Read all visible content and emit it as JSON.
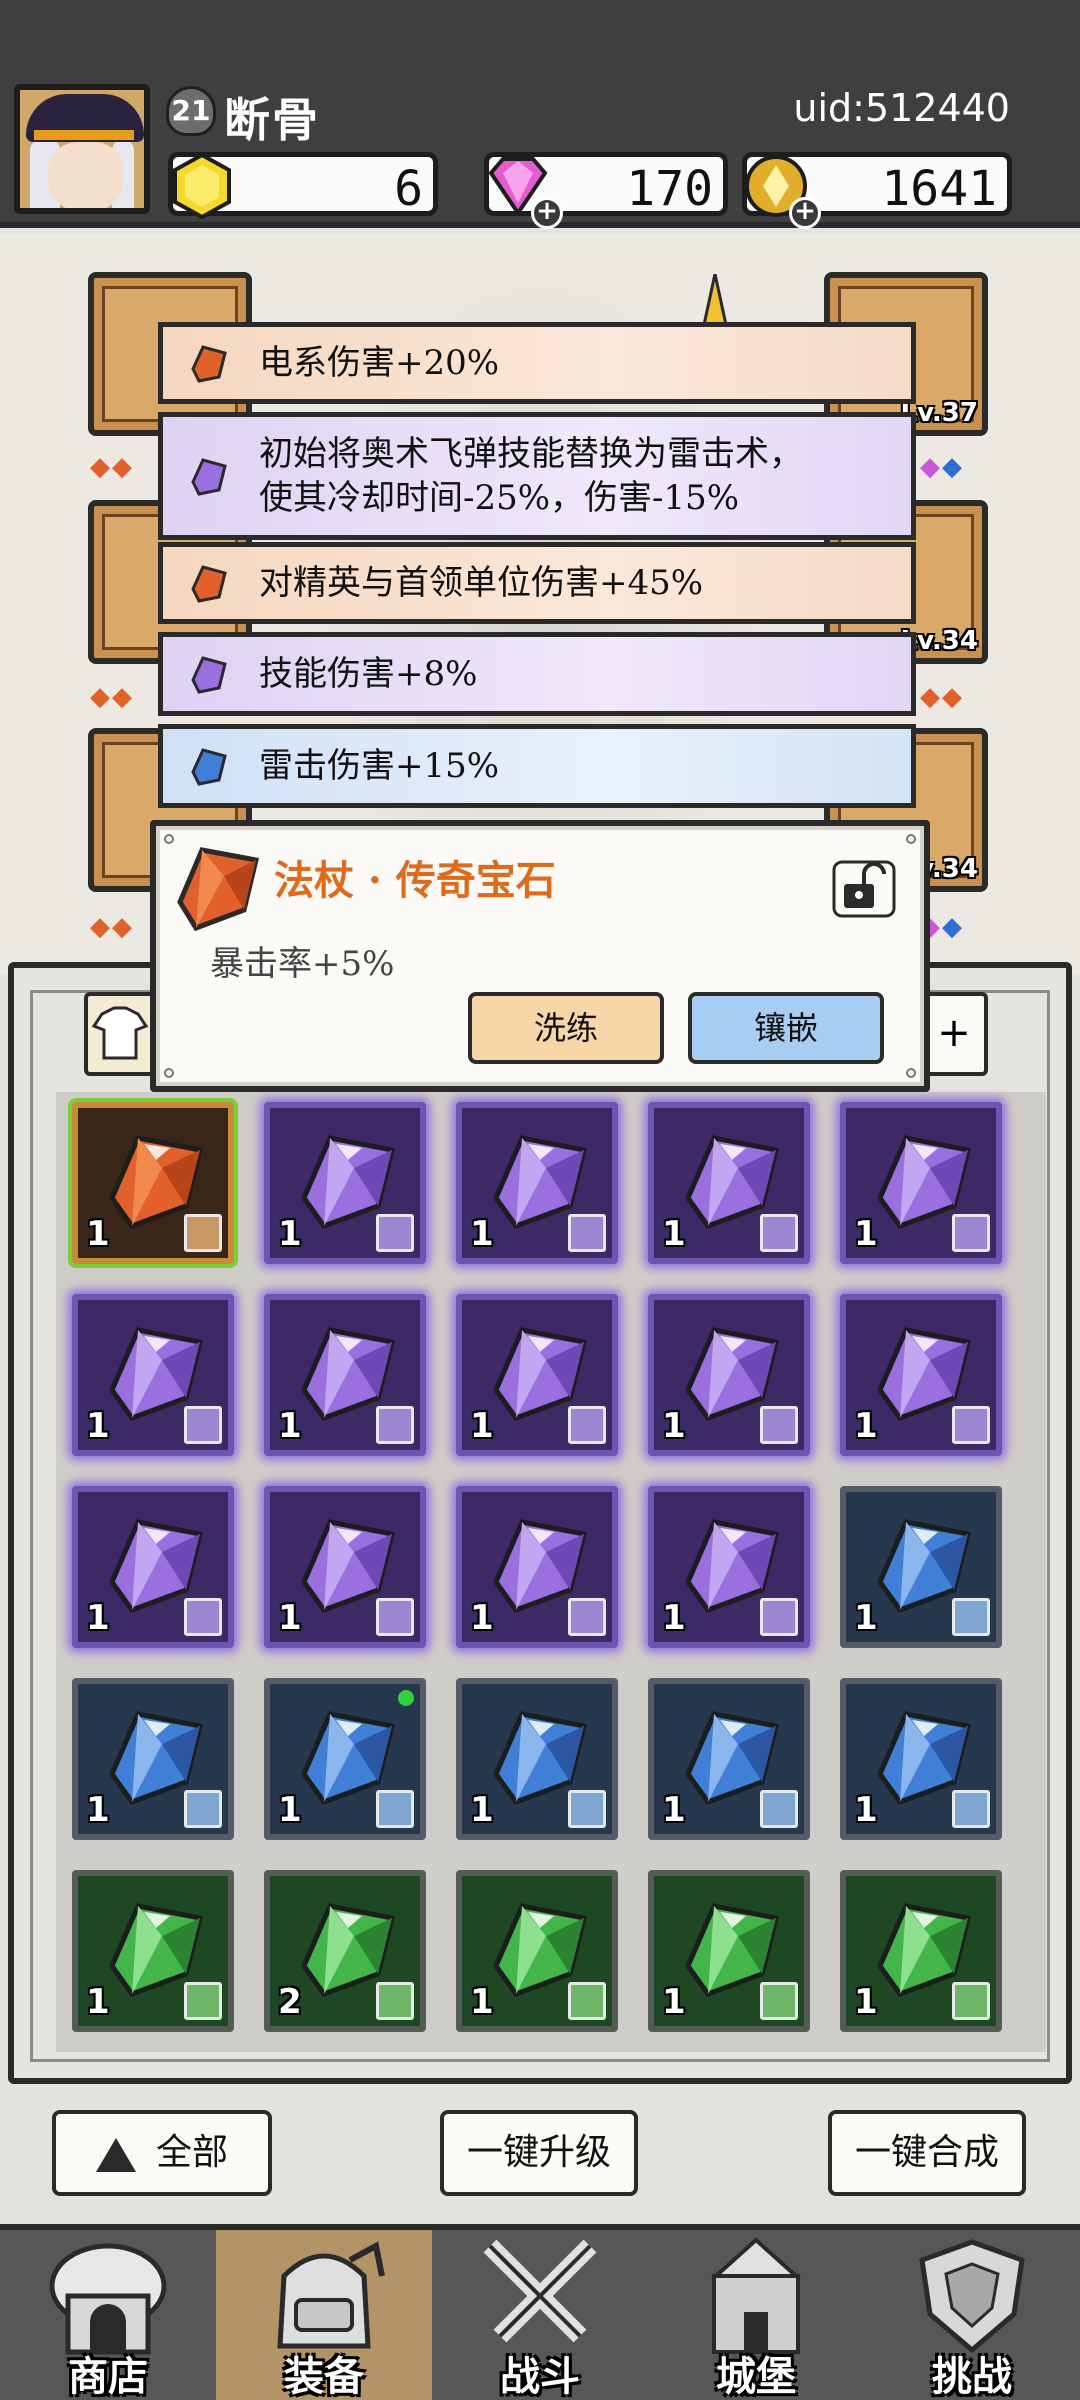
{
  "player": {
    "level": "21",
    "name": "断骨",
    "uid": "uid:512440"
  },
  "currencies": [
    {
      "icon": "gold-hexagon-icon",
      "value": "6",
      "color": "#f0d229"
    },
    {
      "icon": "pink-diamond-icon",
      "value": "170",
      "color": "#e45fd0"
    },
    {
      "icon": "gold-coin-icon",
      "value": "1641",
      "color": "#e3b02e"
    }
  ],
  "equipment": {
    "right_levels": [
      "Lv.37",
      "Lv.34",
      "Lv.34"
    ]
  },
  "stats": [
    {
      "rarity": "orange",
      "text": "电系伤害+20%"
    },
    {
      "rarity": "purple",
      "text": "初始将奥术飞弹技能替换为雷击术，使其冷却时间-25%，伤害-15%",
      "line1": "初始将奥术飞弹技能替换为雷击术，",
      "line2": "使其冷却时间-25%，伤害-15%"
    },
    {
      "rarity": "orange",
      "text": "对精英与首领单位伤害+45%"
    },
    {
      "rarity": "purple",
      "text": "技能伤害+8%"
    },
    {
      "rarity": "blue",
      "text": "雷击伤害+15%"
    }
  ],
  "gem_popup": {
    "title": "法杖 · 传奇宝石",
    "description": "暴击率+5%",
    "refine_label": "洗练",
    "inlay_label": "镶嵌"
  },
  "inventory": {
    "filter_right": "+",
    "items": [
      {
        "rarity": "legend",
        "count": "1",
        "type": "staff-icon"
      },
      {
        "rarity": "epic",
        "count": "1",
        "type": "ring-icon"
      },
      {
        "rarity": "epic",
        "count": "1",
        "type": "armor-icon"
      },
      {
        "rarity": "epic",
        "count": "1",
        "type": "armor-icon"
      },
      {
        "rarity": "epic",
        "count": "1",
        "type": "boot-icon"
      },
      {
        "rarity": "epic",
        "count": "1",
        "type": "staff-icon"
      },
      {
        "rarity": "epic",
        "count": "1",
        "type": "staff-icon"
      },
      {
        "rarity": "epic",
        "count": "1",
        "type": "hat-icon"
      },
      {
        "rarity": "epic",
        "count": "1",
        "type": "hat-icon"
      },
      {
        "rarity": "epic",
        "count": "1",
        "type": "hat-icon"
      },
      {
        "rarity": "epic",
        "count": "1",
        "type": "necklace-icon"
      },
      {
        "rarity": "epic",
        "count": "1",
        "type": "necklace-icon"
      },
      {
        "rarity": "epic",
        "count": "1",
        "type": "necklace-icon"
      },
      {
        "rarity": "epic",
        "count": "1",
        "type": "necklace-icon"
      },
      {
        "rarity": "rare",
        "count": "1",
        "type": "staff-icon"
      },
      {
        "rarity": "rare",
        "count": "1",
        "type": "staff-icon"
      },
      {
        "rarity": "rare",
        "count": "1",
        "type": "staff-icon",
        "new": true
      },
      {
        "rarity": "rare",
        "count": "1",
        "type": "hat-icon"
      },
      {
        "rarity": "rare",
        "count": "1",
        "type": "hat-icon"
      },
      {
        "rarity": "rare",
        "count": "1",
        "type": "hat-icon"
      },
      {
        "rarity": "unc",
        "count": "1",
        "type": "ring-icon"
      },
      {
        "rarity": "unc",
        "count": "2",
        "type": "ring-icon"
      },
      {
        "rarity": "unc",
        "count": "1",
        "type": "armor-icon"
      },
      {
        "rarity": "unc",
        "count": "1",
        "type": "armor-icon"
      },
      {
        "rarity": "unc",
        "count": "1",
        "type": "armor-icon"
      }
    ]
  },
  "actions": {
    "all_label": "全部",
    "upgrade_label": "一键升级",
    "merge_label": "一键合成"
  },
  "nav": [
    {
      "label": "商店",
      "icon": "shop-icon"
    },
    {
      "label": "装备",
      "icon": "backpack-icon",
      "active": true
    },
    {
      "label": "战斗",
      "icon": "crossed-swords-icon"
    },
    {
      "label": "城堡",
      "icon": "castle-icon"
    },
    {
      "label": "挑战",
      "icon": "shield-icon"
    }
  ],
  "colors": {
    "legend_gem": "#e2602a",
    "epic_gem": "#9a6fe0",
    "rare_gem": "#3f7fd6",
    "unc_gem": "#43b64a"
  }
}
